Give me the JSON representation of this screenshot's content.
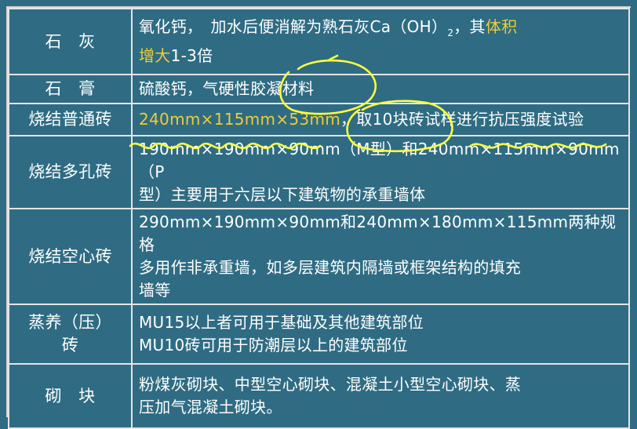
{
  "rows": [
    {
      "label": "石　灰",
      "lines": [
        [
          {
            "t": "氧化钙，　加水后便消解为熟石灰Ca（OH）"
          },
          {
            "t": "2",
            "sub": true
          },
          {
            "t": "，其"
          },
          {
            "t": "体积",
            "hl": true
          }
        ],
        [
          {
            "t": "增大",
            "hl": true
          },
          {
            "t": "1-3倍"
          }
        ]
      ]
    },
    {
      "label": "石　膏",
      "lines": [
        [
          {
            "t": "硫酸钙，气硬性胶凝材料"
          }
        ]
      ]
    },
    {
      "label": "烧结普通砖",
      "lines": [
        [
          {
            "t": "240mm×115mm×53mm",
            "hl": true
          },
          {
            "t": "，取10块砖试样进行抗压强度试验"
          }
        ]
      ]
    },
    {
      "label": "烧结多孔砖",
      "lines": [
        [
          {
            "t": "190mm×190mm×90mm（M型）和240mm×115mm×90mm（P"
          }
        ],
        [
          {
            "t": "型）主要用于六层以下建筑物的承重墙体"
          }
        ]
      ]
    },
    {
      "label": "烧结空心砖",
      "lines": [
        [
          {
            "t": "290mm×190mm×90mm和240mm×180mm×115mm两种规格"
          }
        ],
        [
          {
            "t": "多用作非承重墙，如多层建筑内隔墙或框架结构的填充"
          }
        ],
        [
          {
            "t": "墙等"
          }
        ]
      ]
    },
    {
      "label": "蒸养（压）\n砖",
      "lines": [
        [
          {
            "t": "MU15以上者可用于基础及其他建筑部位"
          }
        ],
        [
          {
            "t": "MU10砖可用于防潮层以上的建筑部位"
          }
        ]
      ]
    },
    {
      "label": "砌　块",
      "lines": [
        [
          {
            "t": "粉煤灰砌块、中型空心砌块、混凝土小型空心砌块、蒸"
          }
        ],
        [
          {
            "t": "压加气混凝土砌块。"
          }
        ]
      ]
    }
  ],
  "colors": {
    "background": "#2f6c83",
    "border": "#e4e4e4",
    "text": "#ffffff",
    "highlight": "#f0cc33",
    "annotation": "#ffff3c"
  }
}
